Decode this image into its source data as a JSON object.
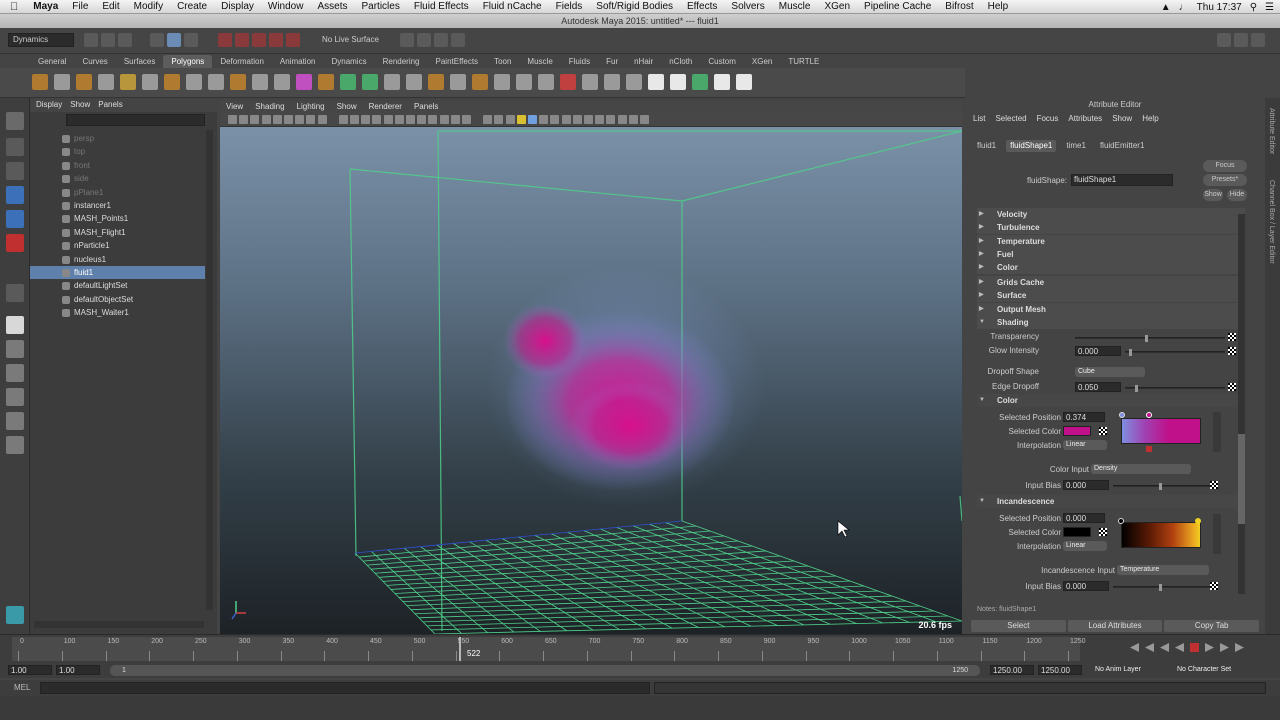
{
  "menubar": {
    "apple": "",
    "app": "Maya",
    "items": [
      "File",
      "Edit",
      "Modify",
      "Create",
      "Display",
      "Window",
      "Assets",
      "Particles",
      "Fluid Effects",
      "Fluid nCache",
      "Fields",
      "Soft/Rigid Bodies",
      "Effects",
      "Solvers",
      "Muscle",
      "XGen",
      "Pipeline Cache",
      "Bifrost",
      "Help"
    ],
    "clock": "Thu 17:37"
  },
  "window_title": "Autodesk Maya 2015: untitled*   ---   fluid1",
  "status": {
    "menuset": "Dynamics",
    "live_surface": "No Live Surface"
  },
  "shelf": {
    "tabs": [
      "General",
      "Curves",
      "Surfaces",
      "Polygons",
      "Deformation",
      "Animation",
      "Dynamics",
      "Rendering",
      "PaintEffects",
      "Toon",
      "Muscle",
      "Fluids",
      "Fur",
      "nHair",
      "nCloth",
      "Custom",
      "XGen",
      "TURTLE"
    ],
    "active_tab": "Polygons"
  },
  "outliner": {
    "menu": [
      "Display",
      "Show",
      "Panels"
    ],
    "items": [
      {
        "label": "persp",
        "dim": true,
        "sel": false
      },
      {
        "label": "top",
        "dim": true,
        "sel": false
      },
      {
        "label": "front",
        "dim": true,
        "sel": false
      },
      {
        "label": "side",
        "dim": true,
        "sel": false
      },
      {
        "label": "pPlane1",
        "dim": true,
        "sel": false
      },
      {
        "label": "instancer1",
        "dim": false,
        "sel": false
      },
      {
        "label": "MASH_Points1",
        "dim": false,
        "sel": false
      },
      {
        "label": "MASH_Flight1",
        "dim": false,
        "sel": false
      },
      {
        "label": "nParticle1",
        "dim": false,
        "sel": false
      },
      {
        "label": "nucleus1",
        "dim": false,
        "sel": false
      },
      {
        "label": "fluid1",
        "dim": false,
        "sel": true
      },
      {
        "label": "defaultLightSet",
        "dim": false,
        "sel": false
      },
      {
        "label": "defaultObjectSet",
        "dim": false,
        "sel": false
      },
      {
        "label": "MASH_Waiter1",
        "dim": false,
        "sel": false
      }
    ]
  },
  "viewport": {
    "menu": [
      "View",
      "Shading",
      "Lighting",
      "Show",
      "Renderer",
      "Panels"
    ],
    "fps": "20.6 fps"
  },
  "attribute_editor": {
    "title": "Attribute Editor",
    "menu": [
      "List",
      "Selected",
      "Focus",
      "Attributes",
      "Show",
      "Help"
    ],
    "tabs": [
      "fluid1",
      "fluidShape1",
      "time1",
      "fluidEmitter1"
    ],
    "active_tab": "fluidShape1",
    "shape_label": "fluidShape:",
    "shape_value": "fluidShape1",
    "buttons_right": [
      "Focus",
      "Presets*",
      "Show",
      "Hide"
    ],
    "sections": [
      "Velocity",
      "Turbulence",
      "Temperature",
      "Fuel",
      "Color",
      "Grids Cache",
      "Surface",
      "Output Mesh",
      "Shading"
    ],
    "shading": {
      "transparency_label": "Transparency",
      "glow_label": "Glow Intensity",
      "glow_value": "0.000",
      "dropoff_shape_label": "Dropoff Shape",
      "dropoff_shape_value": "Cube",
      "edge_dropoff_label": "Edge Dropoff",
      "edge_dropoff_value": "0.050"
    },
    "color": {
      "title": "Color",
      "sel_pos_label": "Selected Position",
      "sel_pos_value": "0.374",
      "sel_color_label": "Selected Color",
      "sel_color": "#c0108a",
      "interp_label": "Interpolation",
      "interp_value": "Linear",
      "input_label": "Color Input",
      "input_value": "Density",
      "bias_label": "Input Bias",
      "bias_value": "0.000"
    },
    "incandescence": {
      "title": "Incandescence",
      "sel_pos_label": "Selected Position",
      "sel_pos_value": "0.000",
      "sel_color_label": "Selected Color",
      "sel_color": "#000000",
      "interp_label": "Interpolation",
      "interp_value": "Linear",
      "input_label": "Incandescence Input",
      "input_value": "Temperature",
      "bias_label": "Input Bias",
      "bias_value": "0.000"
    },
    "notes_label": "Notes: fluidShape1",
    "bottom_buttons": [
      "Select",
      "Load Attributes",
      "Copy Tab"
    ],
    "side_tabs": [
      "Attribute Editor",
      "Channel Box / Layer Editor"
    ]
  },
  "timeline": {
    "ticks": [
      "0",
      "100",
      "150",
      "200",
      "250",
      "300",
      "350",
      "400",
      "450",
      "500",
      "550",
      "600",
      "650",
      "700",
      "750",
      "800",
      "850",
      "900",
      "950",
      "1000",
      "1050",
      "1100",
      "1150",
      "1200",
      "1250"
    ],
    "current_frame": "522",
    "current_frame_value": 522,
    "range_start": "1.00",
    "range_inner_start": "1.00",
    "range_tick": "1",
    "range_inner_end": "1250",
    "range_end_a": "1250.00",
    "range_end_b": "1250.00",
    "anim_layer": "No Anim Layer",
    "char_set": "No Character Set"
  },
  "command_line": {
    "label": "MEL"
  },
  "colors": {
    "accent": "#5f80aa",
    "fluid": "#d0148f",
    "grid": "#4fd08a"
  }
}
